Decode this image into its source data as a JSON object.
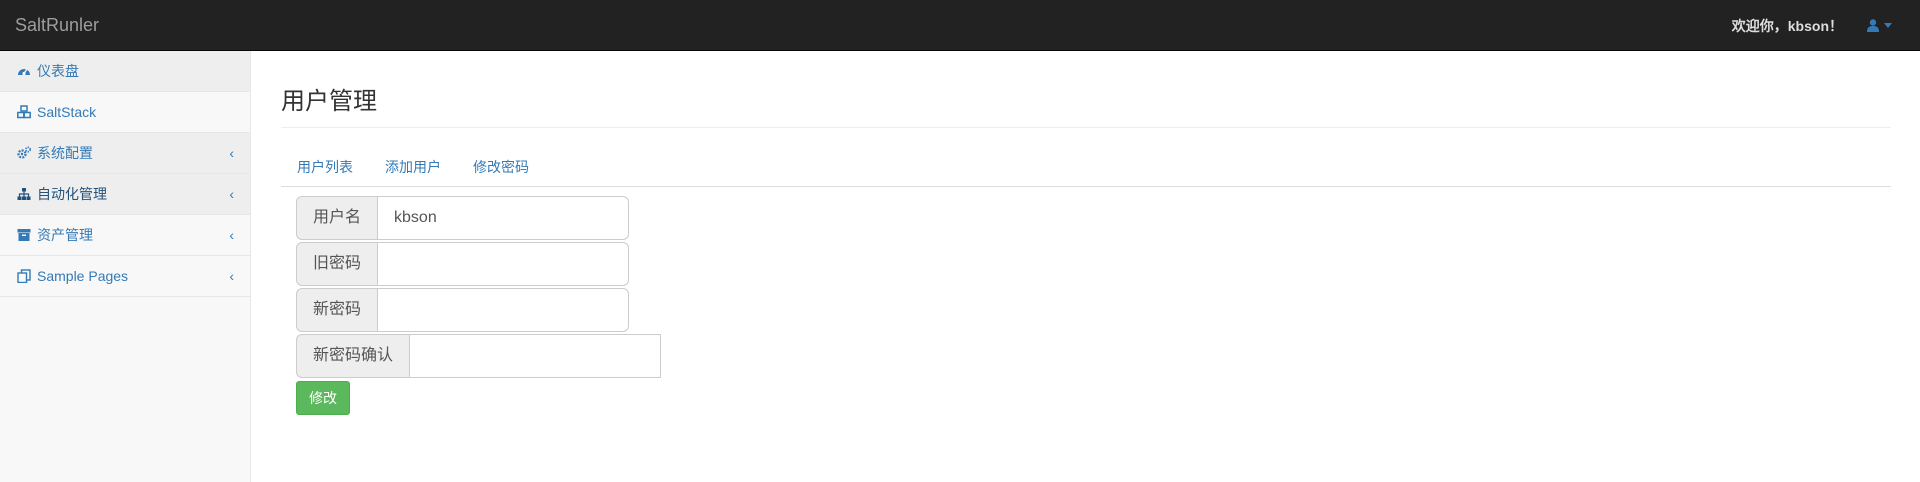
{
  "navbar": {
    "brand": "SaltRunler",
    "welcome": "欢迎你，kbson！"
  },
  "sidebar": {
    "items": [
      {
        "label": "仪表盘",
        "icon": "dashboard-icon",
        "has_submenu": false
      },
      {
        "label": "SaltStack",
        "icon": "cubes-icon",
        "has_submenu": false
      },
      {
        "label": "系统配置",
        "icon": "gears-icon",
        "has_submenu": true,
        "chevron": "‹"
      },
      {
        "label": "自动化管理",
        "icon": "sitemap-icon",
        "has_submenu": true,
        "chevron": "‹"
      },
      {
        "label": "资产管理",
        "icon": "archive-icon",
        "has_submenu": true,
        "chevron": "‹"
      },
      {
        "label": "Sample Pages",
        "icon": "files-icon",
        "has_submenu": true,
        "chevron": "‹"
      }
    ]
  },
  "main": {
    "title": "用户管理",
    "tabs": [
      {
        "label": "用户列表"
      },
      {
        "label": "添加用户"
      },
      {
        "label": "修改密码"
      }
    ],
    "form": {
      "username_label": "用户名",
      "username_value": "kbson",
      "old_password_label": "旧密码",
      "old_password_value": "",
      "new_password_label": "新密码",
      "new_password_value": "",
      "confirm_password_label": "新密码确认",
      "confirm_password_value": "",
      "submit_label": "修改"
    }
  },
  "colors": {
    "navbar_bg": "#222222",
    "link": "#337ab7",
    "submit_bg": "#5cb85c"
  }
}
